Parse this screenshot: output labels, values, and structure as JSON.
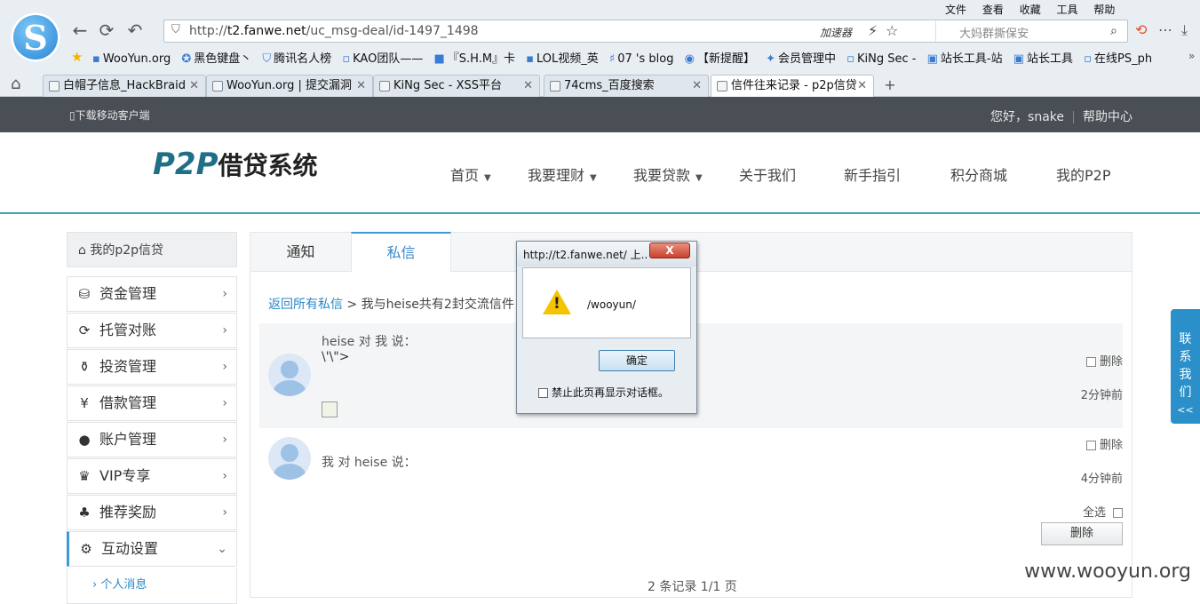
{
  "browser": {
    "logo_letter": "S",
    "url_prefix": "http://",
    "url_host": "t2.fanwe.net",
    "url_path": "/uc_msg-deal/id-1497_1498",
    "accelerator": "加速器",
    "search_placeholder": "大妈群撕保安",
    "menu": [
      "文件",
      "查看",
      "收藏",
      "工具",
      "帮助"
    ],
    "bookmarks": [
      "WooYun.org",
      "黑色键盘丶",
      "腾讯名人榜",
      "KAO团队——",
      "『S.H.M』卡",
      "LOL视频_英",
      "07 's blog",
      "【新提醒】",
      "会员管理中",
      "KiNg Sec -",
      "站长工具-站",
      "站长工具",
      "在线PS_ph"
    ],
    "tabs": [
      {
        "label": "白帽子信息_HackBraid"
      },
      {
        "label": "WooYun.org | 提交漏洞"
      },
      {
        "label": "KiNg Sec - XSS平台"
      },
      {
        "label": "74cms_百度搜索"
      },
      {
        "label": "信件往来记录 - p2p信贷"
      }
    ],
    "close_glyph": "✕"
  },
  "topbar": {
    "mobile": "下载移动客户端",
    "greeting": "您好，snake",
    "help": "帮助中心"
  },
  "header": {
    "brand_en": "P2P",
    "brand_cn": "借贷系统",
    "nav": [
      "首页",
      "我要理财",
      "我要贷款",
      "关于我们",
      "新手指引",
      "积分商城",
      "我的P2P"
    ]
  },
  "sidebar": {
    "head": "我的p2p信贷",
    "items": [
      {
        "label": "资金管理"
      },
      {
        "label": "托管对账"
      },
      {
        "label": "投资管理"
      },
      {
        "label": "借款管理"
      },
      {
        "label": "账户管理"
      },
      {
        "label": "VIP专享"
      },
      {
        "label": "推荐奖励"
      },
      {
        "label": "互动设置"
      }
    ],
    "sub_item": "个人消息"
  },
  "panel": {
    "tabs": [
      "通知",
      "私信"
    ],
    "back_link": "返回所有私信",
    "crumb_rest": " > 我与heise共有2封交流信件",
    "messages": [
      {
        "who": "heise 对 我 说：",
        "body": "\\'\\\">",
        "delete": "删除",
        "time": "2分钟前"
      },
      {
        "who": "我 对 heise 说：",
        "body": "",
        "delete": "删除",
        "time": "4分钟前"
      }
    ],
    "select_all": "全选",
    "delete_button": "删除",
    "pager": "2 条记录 1/1 页"
  },
  "contact_float": {
    "text": [
      "联",
      "系",
      "我",
      "们"
    ],
    "arrow": "<<"
  },
  "watermark": "www.wooyun.org",
  "dialog": {
    "title": "http://t2.fanwe.net/ 上...",
    "close": "X",
    "message": "/wooyun/",
    "ok": "确定",
    "suppress": "禁止此页再显示对话框。"
  }
}
